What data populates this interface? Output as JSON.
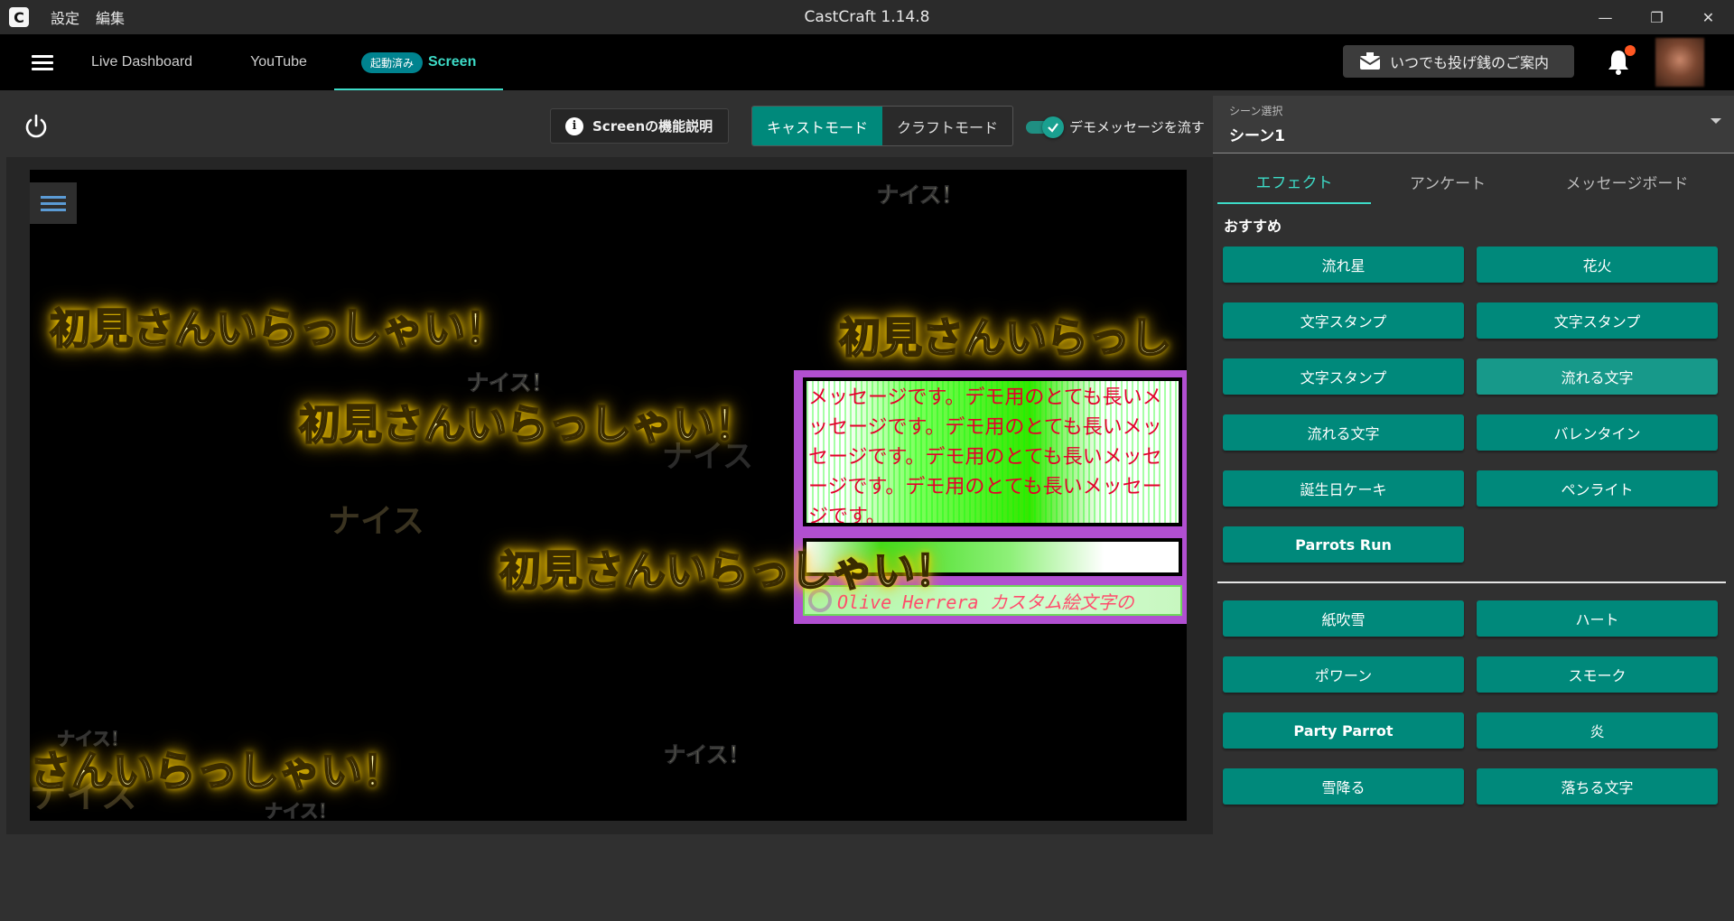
{
  "titlebar": {
    "logo_letter": "C",
    "menu": [
      "設定",
      "編集"
    ],
    "title": "CastCraft 1.14.8",
    "controls": {
      "minimize": "—",
      "restore": "❐",
      "close": "✕"
    }
  },
  "nav": {
    "tabs": [
      "Live Dashboard",
      "YouTube"
    ],
    "active_tab": {
      "badge": "起動済み",
      "label": "Screen"
    },
    "donate_label": "いつでも投げ銭のご案内"
  },
  "toolbar": {
    "info_label": "Screenの機能説明",
    "modes": [
      "キャストモード",
      "クラフトモード"
    ],
    "active_mode": "キャストモード",
    "demo_toggle_label": "デモメッセージを流す",
    "demo_toggle_on": true
  },
  "preview": {
    "welcome_text": "初見さんいらっしゃい！",
    "welcome_partial_right": "初見さんいらっし",
    "welcome_partial_left": "さんいらっしゃい！",
    "nice_text": "ナイス！",
    "ghost_nice": "ナイス",
    "message_text": "メッセージです。デモ用のとても長いメッセージです。デモ用のとても長いメッセージです。デモ用のとても長いメッセージです。デモ用のとても長いメッセージです。",
    "custom_emoji_line": "Olive Herrera カスタム絵文字の"
  },
  "right_panel": {
    "scene_label": "シーン選択",
    "scene_value": "シーン1",
    "tabs": [
      "エフェクト",
      "アンケート",
      "メッセージボード"
    ],
    "active_tab": "エフェクト",
    "section_title": "おすすめ",
    "recommended": [
      "流れ星",
      "花火",
      "文字スタンプ",
      "文字スタンプ",
      "文字スタンプ",
      "流れる文字",
      "流れる文字",
      "バレンタイン",
      "誕生日ケーキ",
      "ペンライト",
      "Parrots Run"
    ],
    "others": [
      "紙吹雪",
      "ハート",
      "ポワーン",
      "スモーク",
      "Party Parrot",
      "炎",
      "雪降る",
      "落ちる文字"
    ]
  },
  "colors": {
    "accent": "#00897b",
    "active_text": "#3ddbc7",
    "notification": "#ff5722"
  }
}
